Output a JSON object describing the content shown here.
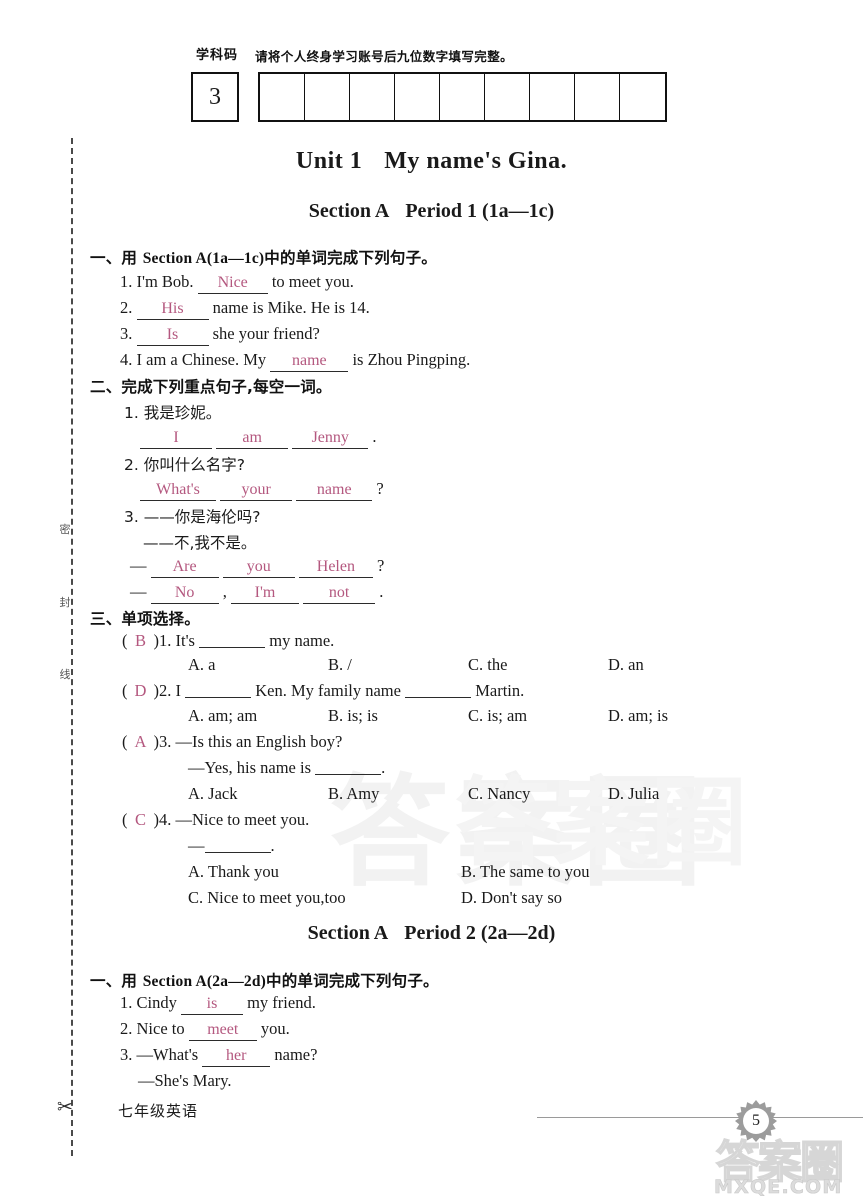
{
  "header": {
    "code_label": "学科码",
    "code_value": "3",
    "note": "请将个人终身学习账号后九位数字填写完整。",
    "digit_cells": [
      "",
      "",
      "",
      "",
      "",
      "",
      "",
      "",
      ""
    ]
  },
  "seal": {
    "chars": [
      "密",
      "封",
      "线"
    ],
    "scissors_icon": "✂"
  },
  "unit": {
    "title_left": "Unit 1",
    "title_right": "My name's Gina."
  },
  "sections": [
    {
      "head_left": "Section A",
      "head_right": "Period 1 (1a—1c)"
    },
    {
      "head_left": "Section A",
      "head_right": "Period 2 (2a—2d)"
    }
  ],
  "ex1": {
    "heading_cn_a": "一、用 ",
    "heading_en": "Section A(1a—1c)",
    "heading_cn_b": "中的单词完成下列句子。",
    "items": [
      {
        "num": "1.",
        "pre": "I'm Bob.",
        "answer": "Nice",
        "post": "to meet you."
      },
      {
        "num": "2.",
        "pre": "",
        "answer": "His",
        "post": "name is Mike.  He is 14."
      },
      {
        "num": "3.",
        "pre": "",
        "answer": "Is",
        "post": "she your friend?"
      },
      {
        "num": "4.",
        "pre": "I am a Chinese. My",
        "answer": "name",
        "post": "is Zhou Pingping."
      }
    ]
  },
  "ex2": {
    "heading": "二、完成下列重点句子,每空一词。",
    "items": [
      {
        "num": "1.",
        "prompt": "我是珍妮。",
        "answers": [
          "I",
          "am",
          "Jenny"
        ],
        "tail": "."
      },
      {
        "num": "2.",
        "prompt": "你叫什么名字?",
        "answers": [
          "What's",
          "your",
          "name"
        ],
        "tail": "?"
      },
      {
        "num": "3.",
        "prompt": "——你是海伦吗?",
        "prompt2": "——不,我不是。",
        "dash": "—",
        "answers_q": [
          "Are",
          "you",
          "Helen"
        ],
        "tail_q": "?",
        "answers_a": [
          "No",
          "I'm",
          "not"
        ],
        "comma": ",",
        "tail_a": "."
      }
    ]
  },
  "ex3": {
    "heading": "三、单项选择。",
    "questions": [
      {
        "pick": "B",
        "num": "1.",
        "stem_pre": "It's",
        "stem_post": "my name.",
        "options": [
          "A. a",
          "B. /",
          "C. the",
          "D. an"
        ]
      },
      {
        "pick": "D",
        "num": "2.",
        "stem_pre": "I",
        "stem_mid": "Ken. My family name",
        "stem_post": "Martin.",
        "options": [
          "A. am; am",
          "B. is; is",
          "C. is; am",
          "D. am; is"
        ]
      },
      {
        "pick": "A",
        "num": "3.",
        "stem_pre": "—Is this an English boy?",
        "stem_line2_pre": "—Yes, his name is",
        "stem_line2_post": ".",
        "options": [
          "A. Jack",
          "B. Amy",
          "C. Nancy",
          "D. Julia"
        ]
      },
      {
        "pick": "C",
        "num": "4.",
        "stem_pre": "—Nice to meet you.",
        "stem_line2_pre": "—",
        "stem_line2_post": ".",
        "options_2col": [
          "A. Thank you",
          "B. The same to you",
          "C. Nice to meet you,too",
          "D. Don't say so"
        ]
      }
    ]
  },
  "ex4": {
    "heading_cn_a": "一、用 ",
    "heading_en": "Section A(2a—2d)",
    "heading_cn_b": "中的单词完成下列句子。",
    "items": [
      {
        "num": "1.",
        "pre": "Cindy",
        "answer": "is",
        "post": "my friend."
      },
      {
        "num": "2.",
        "pre": "Nice to",
        "answer": "meet",
        "post": "you."
      },
      {
        "num": "3.",
        "pre": "—What's",
        "answer": "her",
        "post": "name?"
      }
    ],
    "reply": "—She's Mary."
  },
  "footer": {
    "subject": "七年级英语",
    "page_number": "5",
    "watermark_cn": "答案圈",
    "watermark_site": "MXQE.COM"
  }
}
